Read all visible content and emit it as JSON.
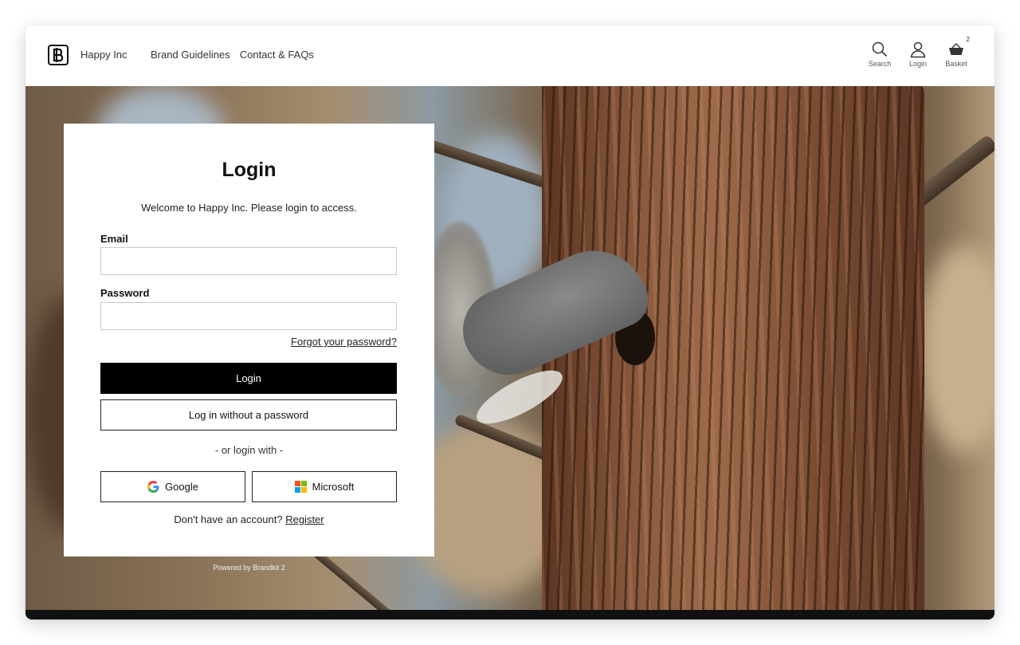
{
  "header": {
    "brand": "Happy Inc",
    "nav": [
      "Brand Guidelines",
      "Contact & FAQs"
    ],
    "tools": {
      "search_label": "Search",
      "login_label": "Login",
      "basket_label": "Basket",
      "basket_count": "2"
    }
  },
  "login": {
    "title": "Login",
    "welcome": "Welcome to Happy Inc. Please login to access.",
    "email_label": "Email",
    "email_value": "",
    "password_label": "Password",
    "password_value": "",
    "forgot": "Forgot your password?",
    "login_button": "Login",
    "passwordless_button": "Log in without a password",
    "or_text": "- or login with -",
    "google_button": "Google",
    "microsoft_button": "Microsoft",
    "no_account": "Don't have an account?",
    "register": "Register"
  },
  "footer": {
    "powered": "Powered by Brandkit 2"
  },
  "colors": {
    "primary_button": "#000000",
    "google_blue": "#4285F4",
    "google_red": "#EA4335",
    "google_yellow": "#FBBC05",
    "google_green": "#34A853",
    "ms_red": "#F25022",
    "ms_green": "#7FBA00",
    "ms_blue": "#00A4EF",
    "ms_yellow": "#FFB900"
  }
}
